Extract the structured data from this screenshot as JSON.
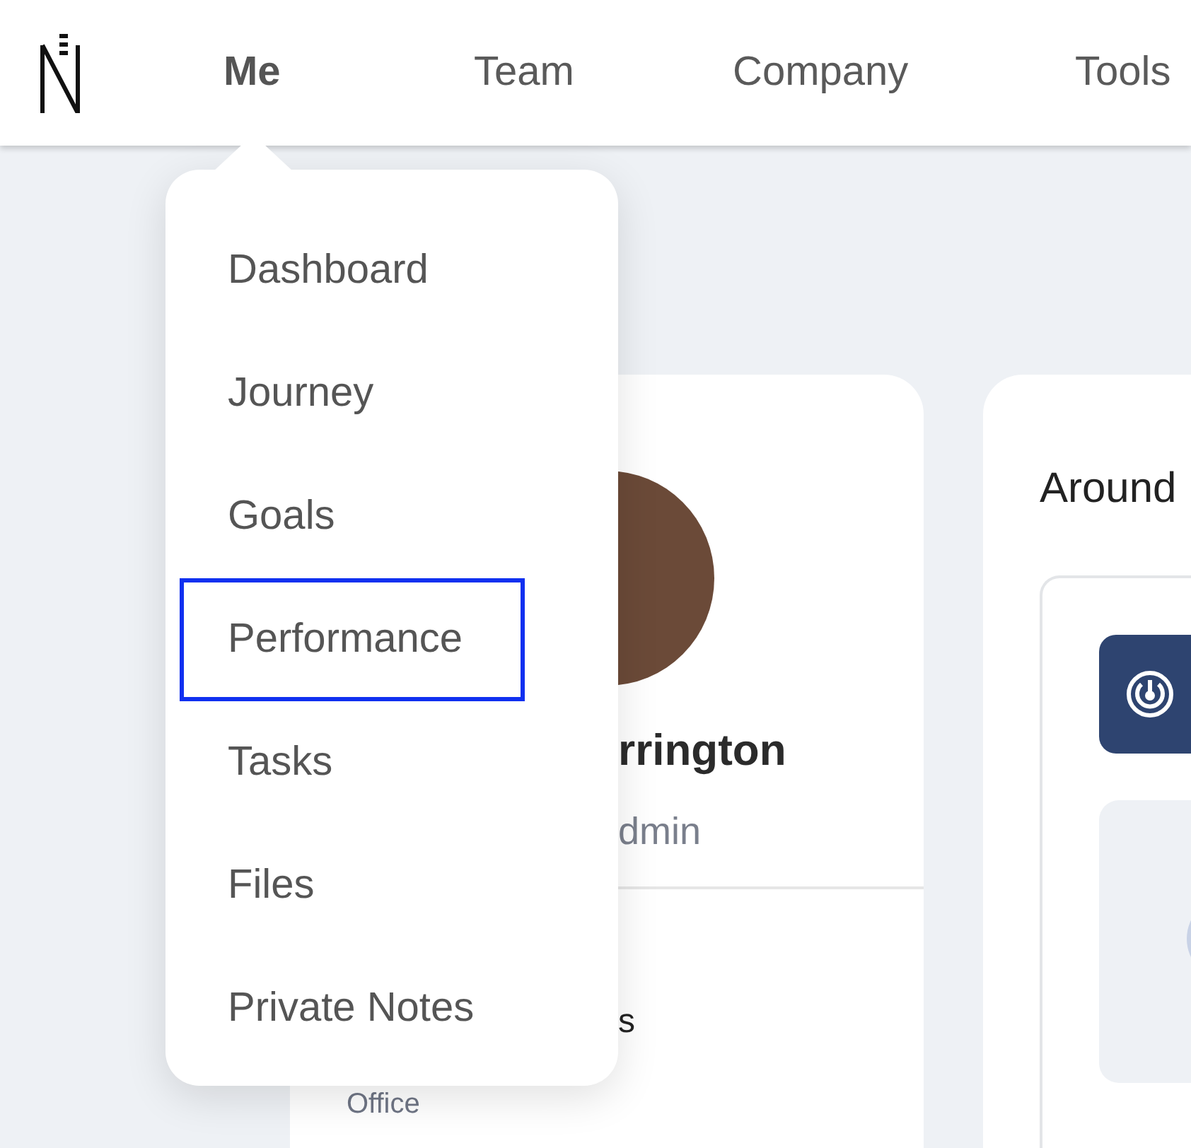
{
  "nav": {
    "tabs": [
      {
        "label": "Me",
        "selected": true
      },
      {
        "label": "Team",
        "selected": false
      },
      {
        "label": "Company",
        "selected": false
      },
      {
        "label": "Tools",
        "selected": false
      }
    ]
  },
  "dropdown": {
    "items": [
      {
        "label": "Dashboard",
        "selected": false
      },
      {
        "label": "Journey",
        "selected": false
      },
      {
        "label": "Goals",
        "selected": false
      },
      {
        "label": "Performance",
        "selected": true
      },
      {
        "label": "Tasks",
        "selected": false
      },
      {
        "label": "Files",
        "selected": false
      },
      {
        "label": "Private Notes",
        "selected": false
      }
    ]
  },
  "profile_card": {
    "name": "rrington",
    "role": "dmin",
    "section_label": "s",
    "location": "Office"
  },
  "feed_card": {
    "title": "Around"
  }
}
